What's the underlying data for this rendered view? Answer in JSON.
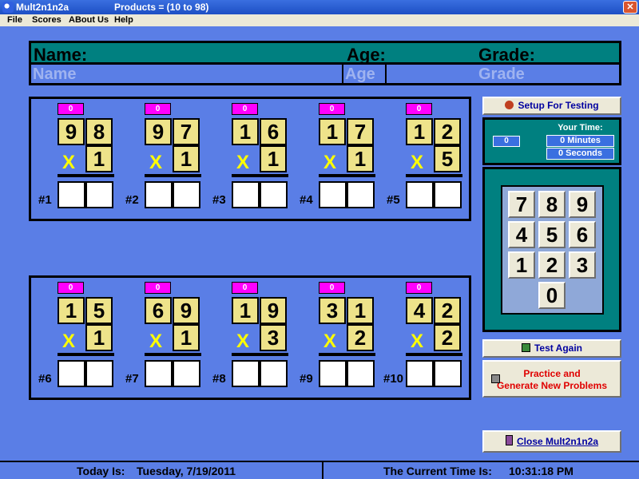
{
  "window": {
    "title": "Mult2n1n2a",
    "subtitle": "Products = (10 to 98)",
    "close_icon": "close-icon"
  },
  "menu": [
    "File",
    "Scores",
    "ABout Us",
    "Help"
  ],
  "student": {
    "name_label": "Name:",
    "age_label": "Age:",
    "grade_label": "Grade:",
    "name_placeholder": "Name",
    "age_placeholder": "Age",
    "grade_placeholder": "Grade"
  },
  "problems": [
    {
      "num": "#1",
      "score": "0",
      "top": [
        "9",
        "8"
      ],
      "multiplier": "1"
    },
    {
      "num": "#2",
      "score": "0",
      "top": [
        "9",
        "7"
      ],
      "multiplier": "1"
    },
    {
      "num": "#3",
      "score": "0",
      "top": [
        "1",
        "6"
      ],
      "multiplier": "1"
    },
    {
      "num": "#4",
      "score": "0",
      "top": [
        "1",
        "7"
      ],
      "multiplier": "1"
    },
    {
      "num": "#5",
      "score": "0",
      "top": [
        "1",
        "2"
      ],
      "multiplier": "5"
    },
    {
      "num": "#6",
      "score": "0",
      "top": [
        "1",
        "5"
      ],
      "multiplier": "1"
    },
    {
      "num": "#7",
      "score": "0",
      "top": [
        "6",
        "9"
      ],
      "multiplier": "1"
    },
    {
      "num": "#8",
      "score": "0",
      "top": [
        "1",
        "9"
      ],
      "multiplier": "3"
    },
    {
      "num": "#9",
      "score": "0",
      "top": [
        "3",
        "1"
      ],
      "multiplier": "2"
    },
    {
      "num": "#10",
      "score": "0",
      "top": [
        "4",
        "2"
      ],
      "multiplier": "2"
    }
  ],
  "times_symbol": "X",
  "buttons": {
    "setup": "Setup For Testing",
    "test_again": "Test Again",
    "practice_line1": "Practice and",
    "practice_line2": "Generate New Problems",
    "close": "Close Mult2n1n2a"
  },
  "timer": {
    "count": "0",
    "label": "Your Time:",
    "minutes": "0 Minutes",
    "seconds": "0 Seconds"
  },
  "keypad": [
    "7",
    "8",
    "9",
    "4",
    "5",
    "6",
    "1",
    "2",
    "3",
    "0"
  ],
  "status": {
    "today_label": "Today Is:",
    "today_value": "Tuesday, 7/19/2011",
    "time_label": "The Current Time Is:",
    "time_value": "10:31:18 PM"
  },
  "colors": {
    "background": "#5a7ee6",
    "panel_teal": "#008080",
    "digit_yellow": "#eee38a",
    "badge_magenta": "#ff00ff",
    "times_yellow": "#ffff00",
    "practice_red": "#e00000"
  }
}
